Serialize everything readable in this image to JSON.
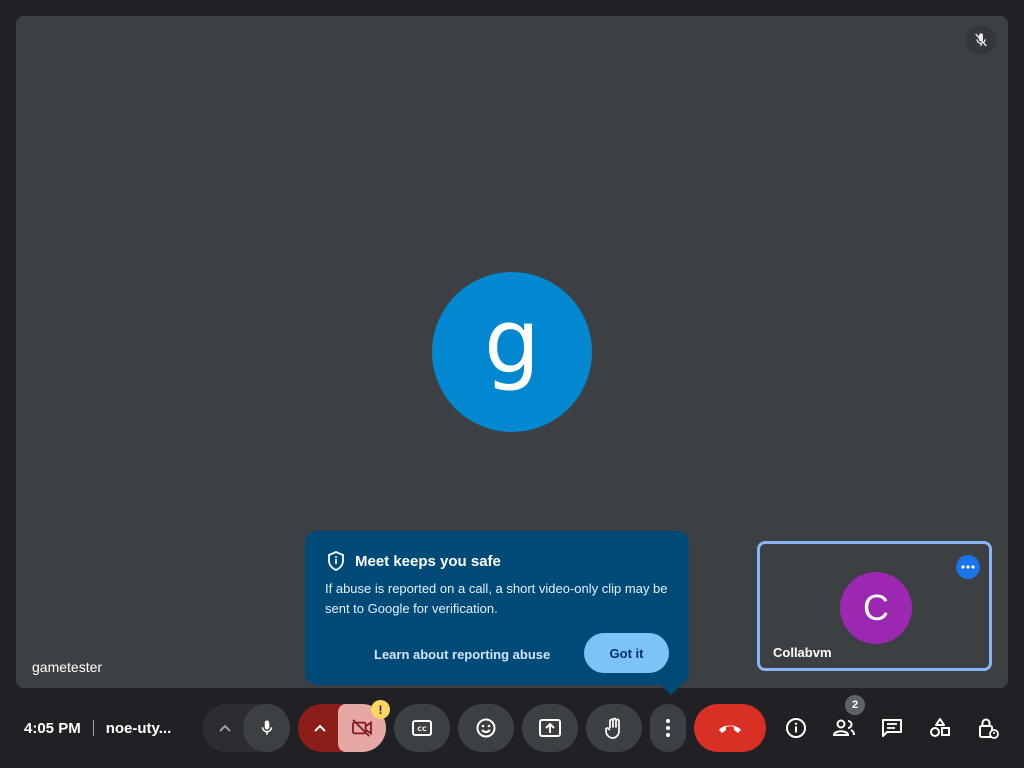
{
  "main": {
    "participant_initial": "g",
    "self_name": "gametester",
    "mute_icon": "mic-off-icon"
  },
  "self_tile": {
    "initial": "C",
    "name": "Collabvm"
  },
  "tooltip": {
    "title": "Meet keeps you safe",
    "body": "If abuse is reported on a call, a short video-only clip may be sent to Google for verification.",
    "link": "Learn about reporting abuse",
    "button": "Got it"
  },
  "toolbar": {
    "time": "4:05 PM",
    "meeting_code": "noe-uty...",
    "camera_warning": "!",
    "people_count": "2"
  },
  "colors": {
    "end_call": "#d93025",
    "camera_off": "#c5221f",
    "accent": "#8ab4f8"
  }
}
